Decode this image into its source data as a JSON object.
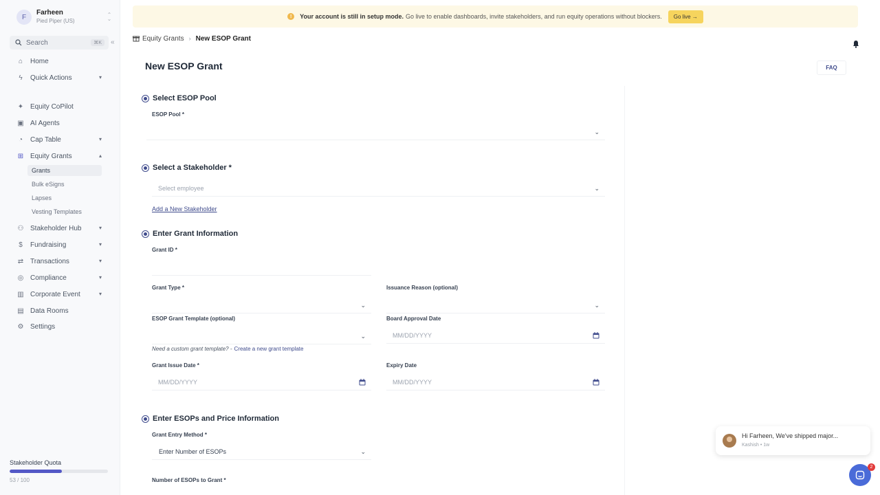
{
  "account": {
    "initial": "F",
    "name": "Farheen",
    "org": "Pied Piper (US)"
  },
  "search": {
    "label": "Search",
    "shortcut": "⌘K"
  },
  "sidebar": {
    "items": [
      {
        "label": "Home",
        "icon": "home-icon"
      },
      {
        "label": "Quick Actions",
        "icon": "bolt-icon"
      },
      {
        "label": "Equity CoPilot",
        "icon": "sparkle-icon"
      },
      {
        "label": "AI Agents",
        "icon": "agent-icon"
      },
      {
        "label": "Cap Table",
        "icon": "pie-icon"
      },
      {
        "label": "Equity Grants",
        "icon": "gift-icon"
      },
      {
        "label": "Stakeholder Hub",
        "icon": "users-icon"
      },
      {
        "label": "Fundraising",
        "icon": "dollar-icon"
      },
      {
        "label": "Transactions",
        "icon": "transactions-icon"
      },
      {
        "label": "Compliance",
        "icon": "shield-icon"
      },
      {
        "label": "Corporate Event",
        "icon": "building-icon"
      },
      {
        "label": "Data Rooms",
        "icon": "folder-icon"
      },
      {
        "label": "Settings",
        "icon": "gear-icon"
      }
    ],
    "grants_sub": [
      "Grants",
      "Bulk eSigns",
      "Lapses",
      "Vesting Templates"
    ],
    "active_sub": "Grants"
  },
  "quota": {
    "title": "Stakeholder Quota",
    "used": 53,
    "total": 100,
    "label": "53 / 100"
  },
  "banner": {
    "bold": "Your account is still in setup mode.",
    "text": "Go live to enable dashboards, invite stakeholders, and run equity operations without blockers.",
    "button": "Go live →"
  },
  "breadcrumb": {
    "parent": "Equity Grants",
    "current": "New ESOP Grant"
  },
  "page": {
    "title": "New ESOP Grant",
    "faq": "FAQ"
  },
  "form": {
    "pool_section": "Select ESOP Pool",
    "pool_label": "ESOP Pool *",
    "stakeholder_section": "Select a Stakeholder *",
    "stakeholder_placeholder": "Select employee",
    "add_stakeholder": "Add a New Stakeholder",
    "grant_section": "Enter Grant Information",
    "grant_id_label": "Grant ID *",
    "grant_type_label": "Grant Type *",
    "issuance_label": "Issuance Reason (optional)",
    "template_label": "ESOP Grant Template (optional)",
    "board_date_label": "Board Approval Date",
    "date_placeholder": "MM/DD/YYYY",
    "template_hint": "Need a custom grant template? -",
    "template_link": "Create a new grant template",
    "issue_date_label": "Grant Issue Date *",
    "expiry_label": "Expiry Date",
    "esop_section": "Enter ESOPs and Price Information",
    "entry_method_label": "Grant Entry Method *",
    "entry_method_value": "Enter Number of ESOPs",
    "num_esops_label": "Number of ESOPs to Grant *"
  },
  "chat": {
    "message": "Hi Farheen,  We've shipped major...",
    "meta": "Kashish • 1w",
    "badge": "2"
  },
  "colors": {
    "accent": "#3f4b8c",
    "banner": "#fdf8e5",
    "golive": "#f6d45d",
    "chat": "#4a6bd8",
    "quota": "#5358c6"
  }
}
